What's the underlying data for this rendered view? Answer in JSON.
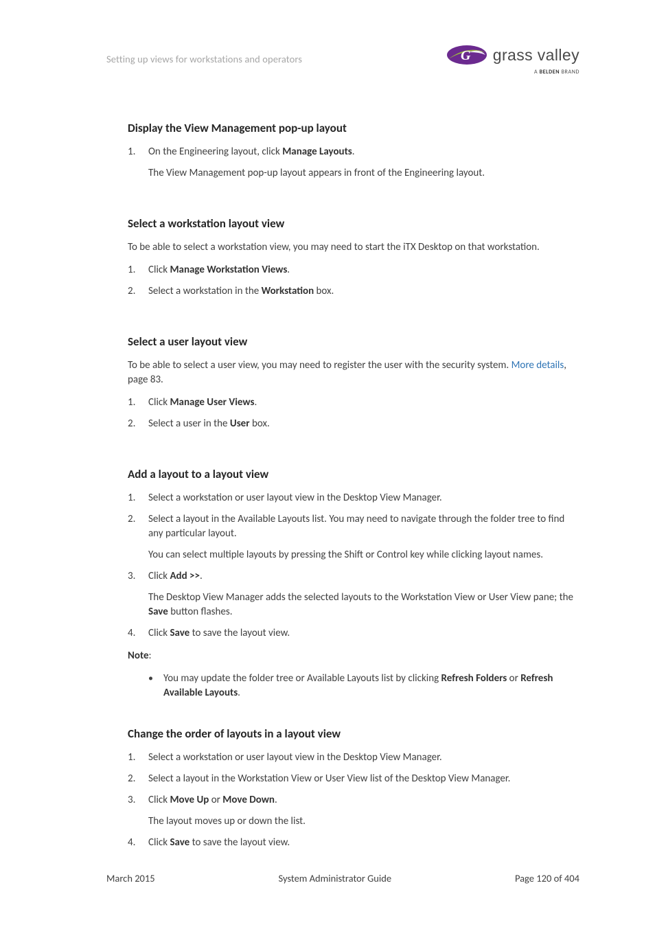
{
  "header": {
    "title": "Setting up views for workstations and operators",
    "logo_text": "grass valley",
    "logo_sub_prefix": "A ",
    "logo_sub_bold": "BELDEN",
    "logo_sub_suffix": " BRAND"
  },
  "sections": {
    "s1": {
      "title": "Display the View Management pop-up layout",
      "step1_a": "On the Engineering layout, click ",
      "step1_b": "Manage Layouts",
      "step1_c": ".",
      "step1_sub": "The View Management pop-up layout appears in front of the Engineering layout."
    },
    "s2": {
      "title": "Select a workstation layout view",
      "intro": "To be able to select a workstation view, you may need to start the iTX Desktop on that workstation.",
      "step1_a": "Click ",
      "step1_b": "Manage Workstation Views",
      "step1_c": ".",
      "step2_a": "Select a workstation in the ",
      "step2_b": "Workstation",
      "step2_c": " box."
    },
    "s3": {
      "title": "Select a user layout view",
      "intro_a": "To be able to select a user view, you may need to register the user with the security system. ",
      "intro_link": "More details",
      "intro_b": ", page 83.",
      "step1_a": "Click ",
      "step1_b": "Manage User Views",
      "step1_c": ".",
      "step2_a": "Select a user in the ",
      "step2_b": "User",
      "step2_c": " box."
    },
    "s4": {
      "title": "Add a layout to a layout view",
      "step1": "Select a workstation or user layout view in the Desktop View Manager.",
      "step2": "Select a layout in the Available Layouts list. You may need to navigate through the folder tree to find any particular layout.",
      "step2_sub": "You can select multiple layouts by pressing the Shift or Control key while clicking layout names.",
      "step3_a": "Click ",
      "step3_b": "Add >>",
      "step3_c": ".",
      "step3_sub_a": "The Desktop View Manager adds the selected layouts to the Workstation View or User View pane; the ",
      "step3_sub_b": "Save",
      "step3_sub_c": " button flashes.",
      "step4_a": "Click ",
      "step4_b": "Save",
      "step4_c": " to save the layout view.",
      "note_label": "Note",
      "note_colon": ":",
      "note_item_a": "You may update the folder tree or Available Layouts list by clicking ",
      "note_item_b": "Refresh Folders",
      "note_item_c": " or ",
      "note_item_d": "Refresh Available Layouts",
      "note_item_e": "."
    },
    "s5": {
      "title": "Change the order of layouts in a layout view",
      "step1": "Select a workstation or user layout view in the Desktop View Manager.",
      "step2": "Select a layout in the Workstation View or User View list of the Desktop View Manager.",
      "step3_a": "Click ",
      "step3_b": "Move Up",
      "step3_c": " or ",
      "step3_d": "Move Down",
      "step3_e": ".",
      "step3_sub": "The layout moves up or down the list.",
      "step4_a": "Click ",
      "step4_b": "Save",
      "step4_c": " to save the layout view."
    }
  },
  "footer": {
    "left": "March 2015",
    "center": "System Administrator Guide",
    "right": "Page 120 of 404"
  }
}
